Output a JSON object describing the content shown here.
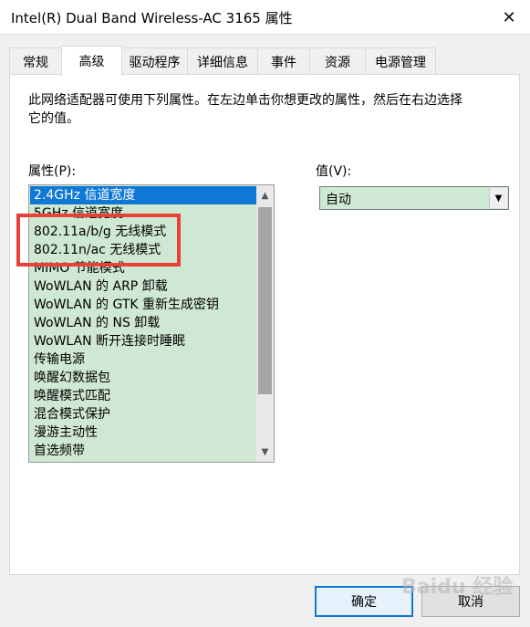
{
  "window": {
    "title": "Intel(R) Dual Band Wireless-AC 3165 属性",
    "close_glyph": "✕"
  },
  "tabs": [
    {
      "label": "常规"
    },
    {
      "label": "高级",
      "active": true
    },
    {
      "label": "驱动程序"
    },
    {
      "label": "详细信息"
    },
    {
      "label": "事件"
    },
    {
      "label": "资源"
    },
    {
      "label": "电源管理"
    }
  ],
  "advanced": {
    "description": "此网络适配器可使用下列属性。在左边单击你想更改的属性，然后在右边选择它的值。",
    "property_label": "属性(P):",
    "value_label": "值(V):",
    "properties": [
      "2.4GHz 信道宽度",
      "5GHz 信道宽度",
      "802.11a/b/g 无线模式",
      "802.11n/ac 无线模式",
      "MIMO 节能模式",
      "WoWLAN 的 ARP 卸载",
      "WoWLAN 的 GTK 重新生成密钥",
      "WoWLAN 的 NS 卸载",
      "WoWLAN 断开连接时睡眠",
      "传输电源",
      "唤醒幻数据包",
      "唤醒模式匹配",
      "混合模式保护",
      "漫游主动性",
      "首选频带"
    ],
    "selected_index": 0,
    "value": "自动"
  },
  "buttons": {
    "ok": "确定",
    "cancel": "取消"
  },
  "watermark": "Baidu 经验",
  "colors": {
    "list_bg": "#cfe8d3",
    "selection": "#0f78d7",
    "highlight_box": "#e8413a"
  }
}
